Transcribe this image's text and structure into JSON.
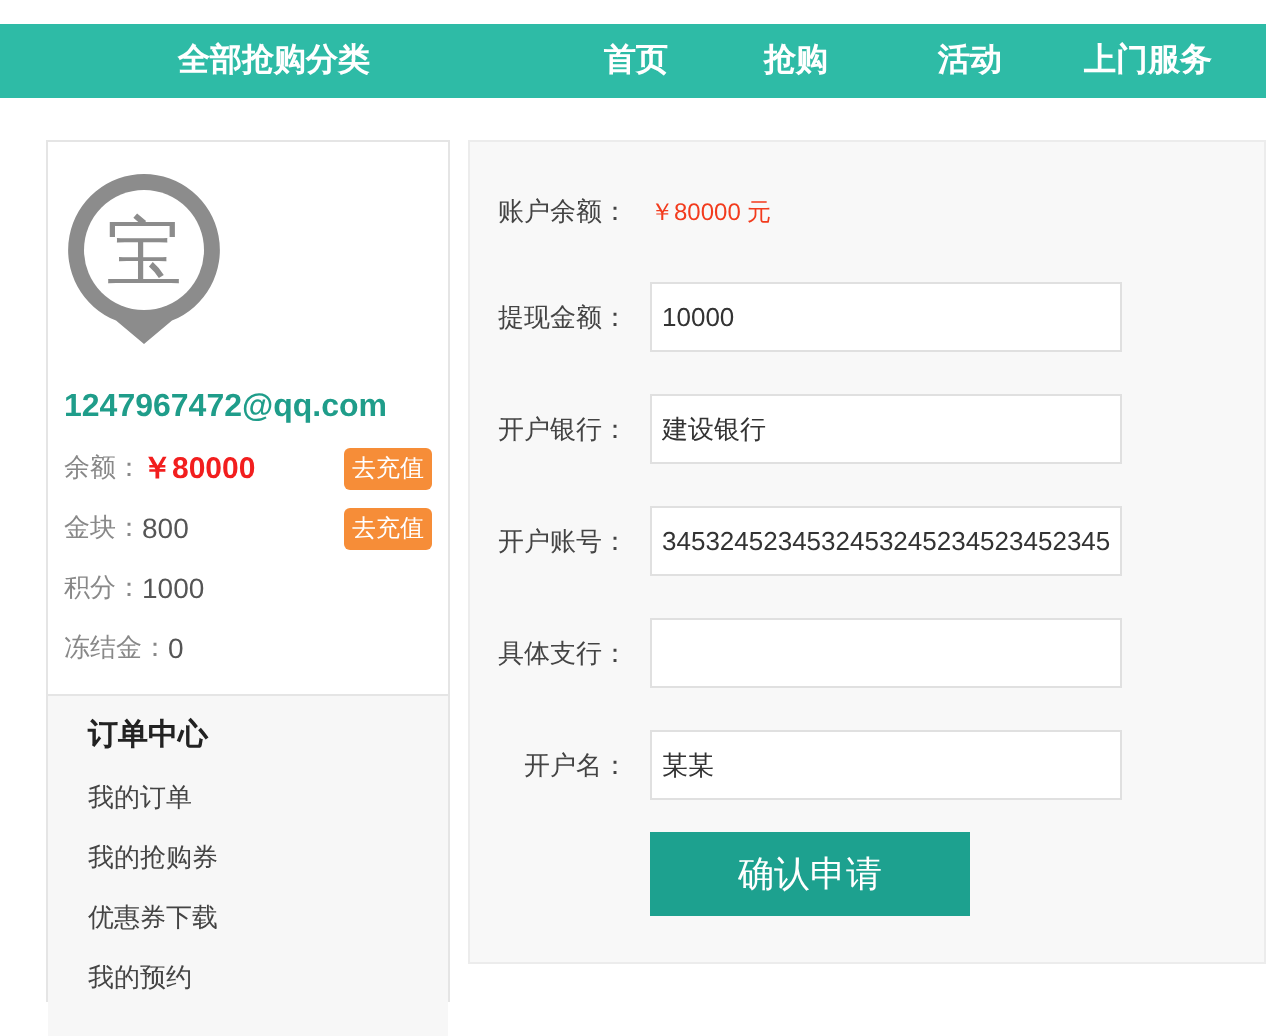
{
  "nav": {
    "category": "全部抢购分类",
    "links": [
      {
        "label": "首页"
      },
      {
        "label": "抢购"
      },
      {
        "label": "活动"
      },
      {
        "label": "上门服务"
      }
    ]
  },
  "profile": {
    "avatar_char": "宝",
    "email": "1247967472@qq.com",
    "stats": [
      {
        "label": "余额：",
        "value": "￥80000",
        "kind": "highlight",
        "action": "去充值"
      },
      {
        "label": "金块：",
        "value": "800",
        "kind": "plain",
        "action": "去充值"
      },
      {
        "label": "积分：",
        "value": "1000",
        "kind": "plain"
      },
      {
        "label": "冻结金：",
        "value": "0",
        "kind": "plain"
      }
    ]
  },
  "order_center": {
    "title": "订单中心",
    "items": [
      {
        "label": "我的订单"
      },
      {
        "label": "我的抢购券"
      },
      {
        "label": "优惠券下载"
      },
      {
        "label": "我的预约"
      }
    ]
  },
  "form": {
    "balance_label": "账户余额：",
    "balance_value": "￥80000 元",
    "fields": [
      {
        "label": "提现金额：",
        "value": "10000"
      },
      {
        "label": "开户银行：",
        "value": "建设银行"
      },
      {
        "label": "开户账号：",
        "value": "3453245234532453245234523452345"
      },
      {
        "label": "具体支行："
      },
      {
        "label": "开户名：",
        "value": "某某"
      }
    ],
    "submit": "确认申请"
  }
}
